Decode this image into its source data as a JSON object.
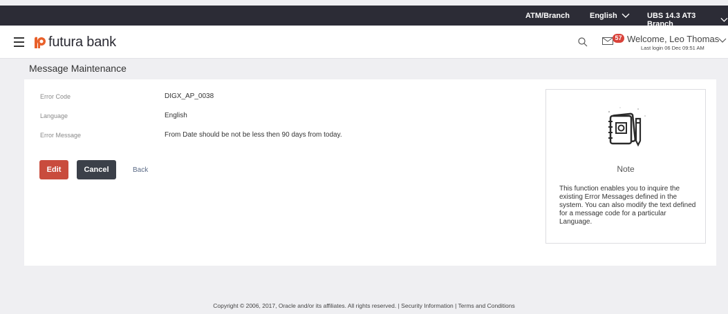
{
  "topbar": {
    "atm_branch": "ATM/Branch",
    "language": "English",
    "branch": "UBS 14.3 AT3 Branch"
  },
  "header": {
    "logo_text": "futura bank",
    "notification_count": "57",
    "welcome": "Welcome, Leo Thomas",
    "last_login": "Last login 06 Dec 09:51 AM"
  },
  "page": {
    "title": "Message Maintenance"
  },
  "details": [
    {
      "label": "Error Code",
      "value": "DIGX_AP_0038"
    },
    {
      "label": "Language",
      "value": "English"
    },
    {
      "label": "Error Message",
      "value": "From Date should be not be less then 90 days from today."
    }
  ],
  "actions": {
    "edit": "Edit",
    "cancel": "Cancel",
    "back": "Back"
  },
  "note": {
    "title": "Note",
    "text": "This function enables you to inquire the existing Error Messages defined in the system. You can also modify the text defined for a message code for a particular Language."
  },
  "footer": {
    "copyright": "Copyright © 2006, 2017, Oracle and/or its affiliates. All rights reserved. | Security Information | Terms and Conditions"
  },
  "colors": {
    "topbar": "#2c2c36",
    "primary_button": "#c94c3d",
    "secondary_button": "#3b4049",
    "badge": "#d9423a",
    "logo_accent": "#e8602a"
  }
}
